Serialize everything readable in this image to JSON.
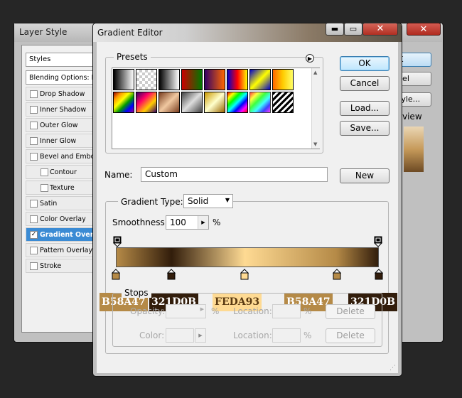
{
  "layer_style": {
    "title": "Layer Style",
    "styles_header": "Styles",
    "blending_options": "Blending Options: D",
    "items": [
      {
        "label": "Drop Shadow",
        "checked": false,
        "indent": false
      },
      {
        "label": "Inner Shadow",
        "checked": false,
        "indent": false
      },
      {
        "label": "Outer Glow",
        "checked": false,
        "indent": false
      },
      {
        "label": "Inner Glow",
        "checked": false,
        "indent": false
      },
      {
        "label": "Bevel and Embos",
        "checked": false,
        "indent": false
      },
      {
        "label": "Contour",
        "checked": false,
        "indent": true
      },
      {
        "label": "Texture",
        "checked": false,
        "indent": true
      },
      {
        "label": "Satin",
        "checked": false,
        "indent": false
      },
      {
        "label": "Color Overlay",
        "checked": false,
        "indent": false
      },
      {
        "label": "Gradient Overl",
        "checked": true,
        "indent": false,
        "selected": true
      },
      {
        "label": "Pattern Overlay",
        "checked": false,
        "indent": false
      },
      {
        "label": "Stroke",
        "checked": false,
        "indent": false
      }
    ],
    "buttons": {
      "ok": "K",
      "cancel": "cel",
      "new_style": "tyle...",
      "preview": "view"
    }
  },
  "gradient_editor": {
    "title": "Gradient Editor",
    "title_buttons": {
      "minimize": "▬",
      "maximize": "▭",
      "close": "✕"
    },
    "presets_label": "Presets",
    "presets_menu_icon": "circle-arrow-right-icon",
    "buttons": {
      "ok": "OK",
      "cancel": "Cancel",
      "load": "Load...",
      "save": "Save...",
      "new": "New"
    },
    "name_label": "Name:",
    "name_value": "Custom",
    "gradient_type_label": "Gradient Type:",
    "gradient_type_value": "Solid",
    "smoothness_label": "Smoothness:",
    "smoothness_value": "100",
    "smoothness_unit": "%",
    "stops_label": "Stops",
    "opacity_label": "Opacity:",
    "color_label": "Color:",
    "location_label": "Location:",
    "percent": "%",
    "delete_label": "Delete",
    "gradient_stops": [
      {
        "hex": "B58A47",
        "color": "#B58A47",
        "location": 0
      },
      {
        "hex": "321D0B",
        "color": "#321D0B",
        "location": 21
      },
      {
        "hex": "FEDA93",
        "color": "#FEDA93",
        "location": 49
      },
      {
        "hex": "B58A47",
        "color": "#B58A47",
        "location": 84
      },
      {
        "hex": "321D0B",
        "color": "#321D0B",
        "location": 100
      }
    ]
  }
}
